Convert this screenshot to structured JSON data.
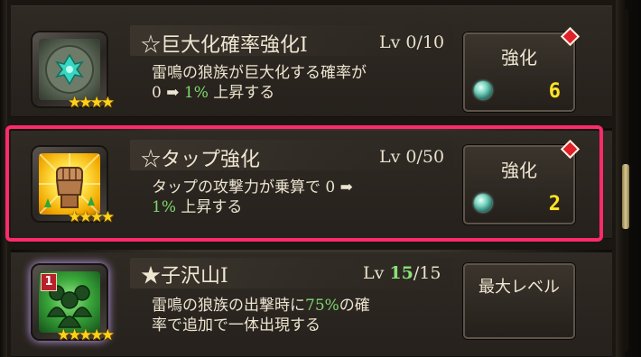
{
  "skills": [
    {
      "title": "☆巨大化確率強化I",
      "level_prefix": "Lv 0/10",
      "desc_line1": "雷鳴の狼族が巨大化する確率が",
      "desc_line2_pre": "0 ➡ ",
      "desc_line2_highlight": "1%",
      "desc_line2_post": " 上昇する",
      "button_label": "強化",
      "cost": "6",
      "stars": "★★★★",
      "icon": "rune-stone-icon"
    },
    {
      "title": "☆タップ強化",
      "level_prefix": "Lv 0/50",
      "desc_line1": "タップの攻撃力が乗算で 0 ➡",
      "desc_line2_highlight": "1%",
      "desc_line2_post": " 上昇する",
      "button_label": "強化",
      "cost": "2",
      "stars": "★★★★",
      "icon": "fist-icon"
    },
    {
      "title": "★子沢山I",
      "level_pre": "Lv ",
      "level_current": "15",
      "level_post": "/15",
      "desc_line1_pre": "雷鳴の狼族の出撃時に",
      "desc_line1_highlight": "75%",
      "desc_line1_post": "の確",
      "desc_line2": "率で追加で一体出現する",
      "button_label": "最大レベル",
      "stars": "★★★★★",
      "rank_badge": "1",
      "icon": "wolf-pack-icon"
    }
  ],
  "colors": {
    "highlight_border": "#ff2a6b",
    "cost_text": "#ffe42a",
    "green_value": "#7fd870",
    "star": "#ffd21a"
  }
}
